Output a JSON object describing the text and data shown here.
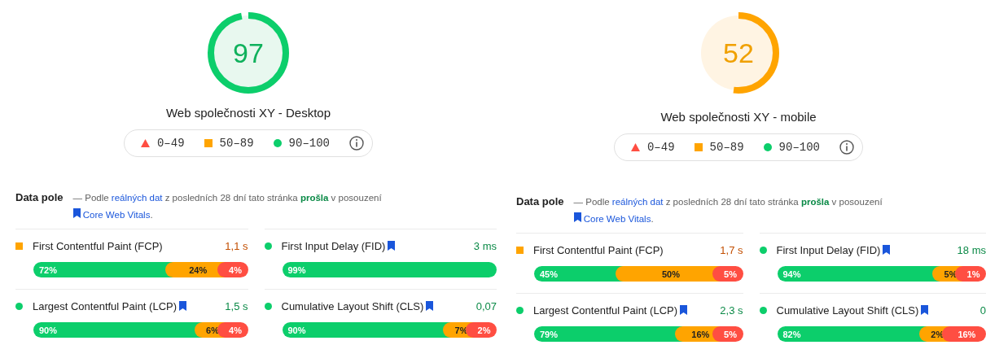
{
  "reports": [
    {
      "score": "97",
      "kind": "good",
      "title": "Web společnosti XY - Desktop",
      "legend": [
        {
          "kind": "poor",
          "label": "0–49"
        },
        {
          "kind": "average",
          "label": "50–89"
        },
        {
          "kind": "good",
          "label": "90–100"
        }
      ],
      "field_data": {
        "heading": "Data pole",
        "sentence": [
          {
            "kind": "text",
            "text": "— Podle "
          },
          {
            "kind": "link",
            "text": "reálných dat"
          },
          {
            "kind": "text",
            "text": " z posledních 28 dní tato stránka "
          },
          {
            "kind": "status",
            "text": "prošla"
          },
          {
            "kind": "text",
            "text": " v posouzení "
          },
          {
            "kind": "bookmark_link",
            "text": "Core Web Vitals"
          },
          {
            "kind": "text",
            "text": "."
          }
        ]
      },
      "metrics": [
        {
          "name": "First Contentful Paint (FCP)",
          "kind": "average",
          "core_web_vital": false,
          "value": "1,1 s",
          "segments": [
            {
              "kind": "good",
              "label": "72%"
            },
            {
              "kind": "average",
              "label": "24%"
            },
            {
              "kind": "poor",
              "label": "4%"
            }
          ]
        },
        {
          "name": "First Input Delay (FID)",
          "kind": "good",
          "core_web_vital": true,
          "value": "3 ms",
          "segments": [
            {
              "kind": "good",
              "label": "99%"
            }
          ]
        },
        {
          "name": "Largest Contentful Paint (LCP)",
          "kind": "good",
          "core_web_vital": true,
          "value": "1,5 s",
          "segments": [
            {
              "kind": "good",
              "label": "90%"
            },
            {
              "kind": "average",
              "label": "6%"
            },
            {
              "kind": "poor",
              "label": "4%"
            }
          ]
        },
        {
          "name": "Cumulative Layout Shift (CLS)",
          "kind": "good",
          "core_web_vital": true,
          "value": "0,07",
          "segments": [
            {
              "kind": "good",
              "label": "90%"
            },
            {
              "kind": "average",
              "label": "7%"
            },
            {
              "kind": "poor",
              "label": "2%"
            }
          ]
        }
      ]
    },
    {
      "score": "52",
      "kind": "average",
      "title": "Web společnosti XY - mobile",
      "legend": [
        {
          "kind": "poor",
          "label": "0–49"
        },
        {
          "kind": "average",
          "label": "50–89"
        },
        {
          "kind": "good",
          "label": "90–100"
        }
      ],
      "field_data": {
        "heading": "Data pole",
        "sentence": [
          {
            "kind": "text",
            "text": "— Podle "
          },
          {
            "kind": "link",
            "text": "reálných dat"
          },
          {
            "kind": "text",
            "text": " z posledních 28 dní tato stránka "
          },
          {
            "kind": "status",
            "text": "prošla"
          },
          {
            "kind": "text",
            "text": " v posouzení "
          },
          {
            "kind": "bookmark_link",
            "text": "Core Web Vitals"
          },
          {
            "kind": "text",
            "text": "."
          }
        ]
      },
      "metrics": [
        {
          "name": "First Contentful Paint (FCP)",
          "kind": "average",
          "core_web_vital": false,
          "value": "1,7 s",
          "segments": [
            {
              "kind": "good",
              "label": "45%"
            },
            {
              "kind": "average",
              "label": "50%"
            },
            {
              "kind": "poor",
              "label": "5%"
            }
          ]
        },
        {
          "name": "First Input Delay (FID)",
          "kind": "good",
          "core_web_vital": true,
          "value": "18 ms",
          "segments": [
            {
              "kind": "good",
              "label": "94%"
            },
            {
              "kind": "average",
              "label": "5%"
            },
            {
              "kind": "poor",
              "label": "1%"
            }
          ]
        },
        {
          "name": "Largest Contentful Paint (LCP)",
          "kind": "good",
          "core_web_vital": true,
          "value": "2,3 s",
          "segments": [
            {
              "kind": "good",
              "label": "79%"
            },
            {
              "kind": "average",
              "label": "16%"
            },
            {
              "kind": "poor",
              "label": "5%"
            }
          ]
        },
        {
          "name": "Cumulative Layout Shift (CLS)",
          "kind": "good",
          "core_web_vital": true,
          "value": "0",
          "segments": [
            {
              "kind": "good",
              "label": "82%"
            },
            {
              "kind": "average",
              "label": "2%"
            },
            {
              "kind": "poor",
              "label": "16%"
            }
          ]
        }
      ]
    }
  ]
}
